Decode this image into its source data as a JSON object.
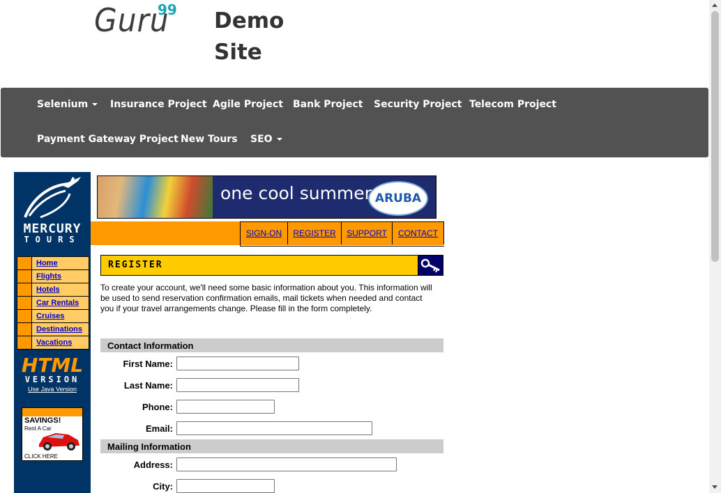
{
  "header": {
    "logo_text": "Guru",
    "logo_sup": "99",
    "site_title": "Demo Site"
  },
  "navbar": {
    "items": [
      {
        "label": "Selenium",
        "dropdown": true
      },
      {
        "label": "Insurance Project"
      },
      {
        "label": "Agile Project"
      },
      {
        "label": "Bank Project"
      },
      {
        "label": "Security Project"
      },
      {
        "label": "Telecom Project"
      },
      {
        "label": "Payment Gateway Project"
      },
      {
        "label": "New Tours"
      },
      {
        "label": "SEO",
        "dropdown": true
      }
    ]
  },
  "mercury": {
    "brand_line1": "MERCURY",
    "brand_line2": "TOURS",
    "menu": [
      {
        "label": "Home"
      },
      {
        "label": "Flights"
      },
      {
        "label": "Hotels"
      },
      {
        "label": "Car Rentals"
      },
      {
        "label": "Cruises"
      },
      {
        "label": "Destinations"
      },
      {
        "label": "Vacations"
      }
    ],
    "html_version_line1": "HTML",
    "html_version_line2": "VERSION",
    "java_link": "Use Java Version",
    "ad": {
      "title": "SAVINGS!",
      "subtitle": "Rent A Car",
      "cta": "CLICK HERE"
    }
  },
  "banner": {
    "text": "one cool summer",
    "logo": "ARUBA"
  },
  "tabs": [
    {
      "label": "SIGN-ON"
    },
    {
      "label": "REGISTER"
    },
    {
      "label": "SUPPORT"
    },
    {
      "label": "CONTACT"
    }
  ],
  "register": {
    "title": "REGISTER",
    "intro": "To create your account, we'll need some basic information about you. This information will be used to send reservation confirmation emails, mail tickets when needed and contact you if your travel arrangements change. Please fill in the form completely.",
    "sections": {
      "contact": "Contact Information",
      "mailing": "Mailing Information"
    },
    "fields": {
      "first_name": {
        "label": "First Name:",
        "value": ""
      },
      "last_name": {
        "label": "Last Name:",
        "value": ""
      },
      "phone": {
        "label": "Phone:",
        "value": ""
      },
      "email": {
        "label": "Email:",
        "value": ""
      },
      "address": {
        "label": "Address:",
        "value": ""
      },
      "city": {
        "label": "City:",
        "value": ""
      }
    }
  },
  "colors": {
    "navbar": "#525252",
    "mercury_blue": "#003366",
    "orange": "#ff9900",
    "register_yellow": "#ffcc00",
    "link_blue": "#0000cc",
    "logo_accent": "#1aa5b5"
  }
}
